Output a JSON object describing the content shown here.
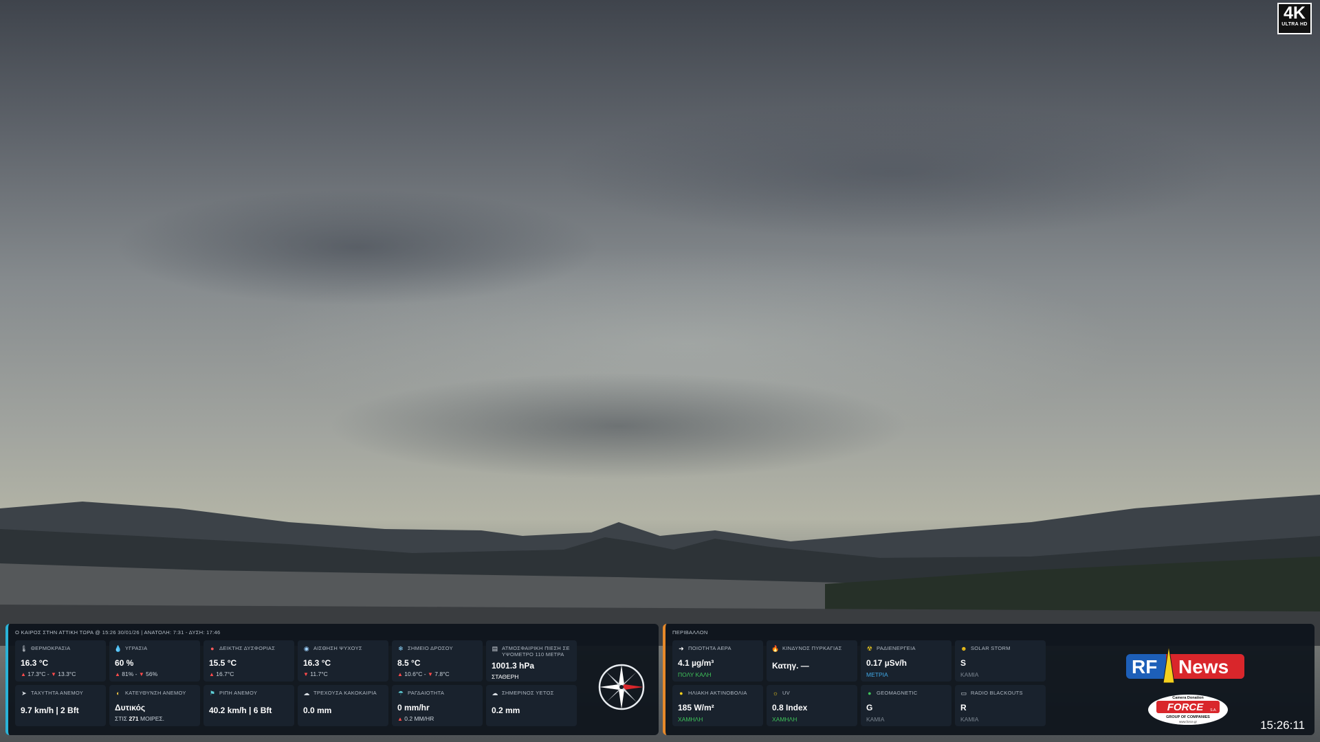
{
  "badge_4k": {
    "big": "4K",
    "small": "ULTRA HD"
  },
  "weather_panel": {
    "title": "Ο ΚΑΙΡΟΣ ΣΤΗΝ ΑΤΤΙΚΗ ΤΩΡΑ @ 15:26 30/01/26 | ΑΝΑΤΟΛΗ: 7:31 - ΔΥΣΗ: 17:46",
    "cards": [
      {
        "label": "ΘΕΡΜΟΚΡΑΣΙΑ",
        "icon": "thermometer-icon",
        "value": "16.3 °C",
        "hi": "17.3°C",
        "lo": "13.3°C",
        "sep": " - "
      },
      {
        "label": "ΥΓΡΑΣΙΑ",
        "icon": "droplet-icon",
        "value": "60 %",
        "hi": "81%",
        "lo": "56%",
        "sep": " - "
      },
      {
        "label": "ΔΕΙΚΤΗΣ ΔΥΣΦΟΡΙΑΣ",
        "icon": "discomfort-icon",
        "value": "15.5 °C",
        "hi": "16.7°C"
      },
      {
        "label": "ΑΙΣΘΗΣΗ ΨΥΧΟΥΣ",
        "icon": "wind-chill-icon",
        "value": "16.3 °C",
        "lo": "11.7°C"
      },
      {
        "label": "ΣΗΜΕΙΟ ΔΡΟΣΟΥ",
        "icon": "snowflake-icon",
        "value": "8.5 °C",
        "hi": "10.6°C",
        "lo": "7.8°C",
        "sep": " - "
      },
      {
        "label": "ΑΤΜΟΣΦΑΙΡΙΚΗ ΠΙΕΣΗ ΣΕ ΥΨΟΜΕΤΡΟ 110 ΜΕΤΡΑ",
        "icon": "barometer-icon",
        "value": "1001.3 hPa",
        "note": "ΣΤΑΘΕΡΗ"
      },
      {
        "label": "ΤΑΧΥΤΗΤΑ ΑΝΕΜΟΥ",
        "icon": "wind-icon",
        "value": "9.7 km/h | 2 Bft"
      },
      {
        "label": "ΚΑΤΕΥΘΥΝΣΗ ΑΝΕΜΟΥ",
        "icon": "direction-icon",
        "value": "Δυτικός",
        "note_prefix": "ΣΤΙΣ",
        "note_bold": "271",
        "note_suffix": "ΜΟΙΡΕΣ."
      },
      {
        "label": "ΡΙΠΗ ΑΝΕΜΟΥ",
        "icon": "gust-icon",
        "value": "40.2 km/h | 6 Bft"
      },
      {
        "label": "ΤΡΕΧΟΥΣΑ ΚΑΚΟΚΑΙΡΙΑ",
        "icon": "storm-cloud-icon",
        "value": "0.0 mm"
      },
      {
        "label": "ΡΑΓΔΑΙΟΤΗΤΑ",
        "icon": "rain-rate-icon",
        "value": "0 mm/hr",
        "hi": "0.2 MM/HR"
      },
      {
        "label": "ΣΗΜΕΡΙΝΟΣ ΥΕΤΟΣ",
        "icon": "rain-cloud-icon",
        "value": "0.2 mm"
      }
    ]
  },
  "environment_panel": {
    "title": "ΠΕΡΙΒΑΛΛΟΝ",
    "cards": [
      {
        "label": "ΠΟΙΟΤΗΤΑ ΑΕΡΑ",
        "icon": "air-quality-icon",
        "value": "4.1 µg/m³",
        "status": "ΠΟΛΥ ΚΑΛΗ",
        "status_color": "#3fc35a"
      },
      {
        "label": "ΚΙΝΔΥΝΟΣ ΠΥΡΚΑΓΙΑΣ",
        "icon": "fire-icon",
        "value": "Κατηγ. —",
        "status": "",
        "status_color": "#7b8590"
      },
      {
        "label": "ΡΑΔΙΕΝΕΡΓΕΙΑ",
        "icon": "radiation-icon",
        "value": "0.17 µSv/h",
        "status": "ΜΕΤΡΙΑ",
        "status_color": "#40a8e6"
      },
      {
        "label": "SOLAR STORM",
        "icon": "solar-storm-icon",
        "value": "S",
        "status": "ΚΑΜΙΑ",
        "status_color": "#7b8590"
      },
      {
        "label": "ΗΛΙΑΚΗ ΑΚΤΙΝΟΒΟΛΙΑ",
        "icon": "sun-icon",
        "value": "185 W/m²",
        "status": "ΧΑΜΗΛΗ",
        "status_color": "#3fc35a"
      },
      {
        "label": "UV",
        "icon": "uv-icon",
        "value": "0.8 Index",
        "status": "ΧΑΜΗΛΗ",
        "status_color": "#3fc35a"
      },
      {
        "label": "GEOMAGNETIC",
        "icon": "globe-icon",
        "value": "G",
        "status": "ΚΑΜΙΑ",
        "status_color": "#7b8590"
      },
      {
        "label": "RADIO BLACKOUTS",
        "icon": "radio-icon",
        "value": "R",
        "status": "ΚΑΜΙΑ",
        "status_color": "#7b8590"
      }
    ]
  },
  "logos": {
    "rf_news": {
      "left": "RF",
      "right": "News"
    },
    "force": {
      "top": "Camera Donation",
      "name": "FORCE",
      "suffix": "S.A.",
      "sub": "GROUP OF COMPANIES",
      "url": "www.force.gr"
    }
  },
  "clock": "15:26:11",
  "colors": {
    "weather_accent": "#2ab3d8",
    "env_accent": "#e6892a",
    "up_arrow": "#ff4b4b"
  }
}
